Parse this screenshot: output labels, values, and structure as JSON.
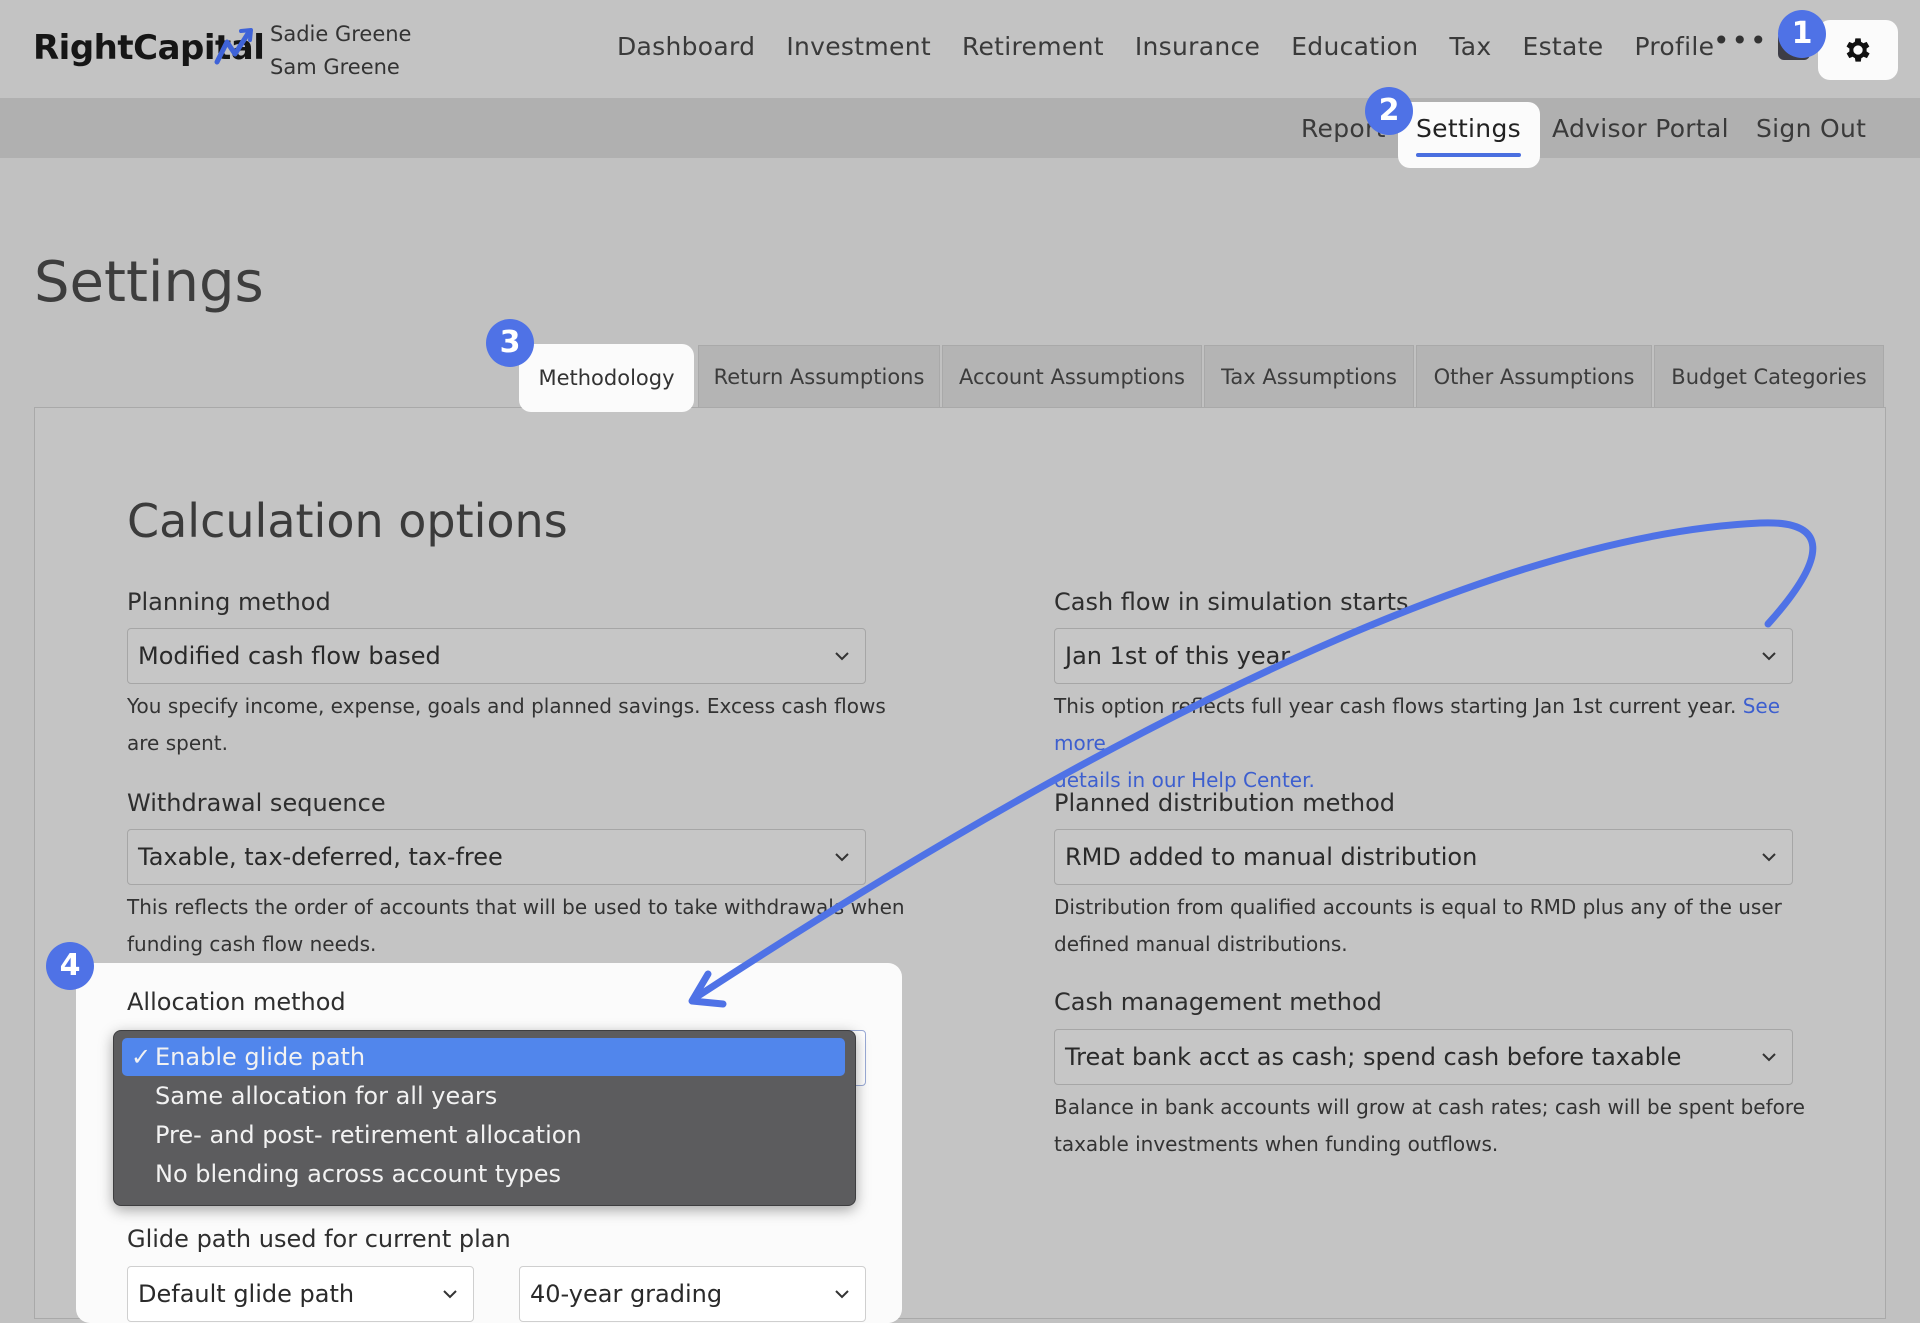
{
  "brand": {
    "name": "RightCapital"
  },
  "clients": [
    "Sadie Greene",
    "Sam Greene"
  ],
  "main_nav": [
    "Dashboard",
    "Investment",
    "Retirement",
    "Insurance",
    "Education",
    "Tax",
    "Estate",
    "Profile"
  ],
  "more_label": "•••",
  "sub_nav": {
    "report": "Report",
    "settings": "Settings",
    "advisor_portal": "Advisor Portal",
    "sign_out": "Sign Out"
  },
  "badges": [
    "1",
    "2",
    "3",
    "4"
  ],
  "page_title": "Settings",
  "tabs": [
    "Methodology",
    "Return Assumptions",
    "Account Assumptions",
    "Tax Assumptions",
    "Other Assumptions",
    "Budget Categories"
  ],
  "section_title": "Calculation options",
  "fields": {
    "planning_method": {
      "label": "Planning method",
      "value": "Modified cash flow based",
      "help1": "You specify income, expense, goals and planned savings. Excess cash flows",
      "help2": "are spent."
    },
    "withdrawal_sequence": {
      "label": "Withdrawal sequence",
      "value": "Taxable, tax-deferred, tax-free",
      "help1": "This reflects the order of accounts that will be used to take withdrawals when",
      "help2": "funding cash flow needs."
    },
    "allocation_method": {
      "label": "Allocation method",
      "options": [
        "Enable glide path",
        "Same allocation for all years",
        "Pre- and post- retirement allocation",
        "No blending across account types"
      ],
      "selected_mark": "✓"
    },
    "glide_path": {
      "label": "Glide path used for current plan",
      "value1": "Default glide path",
      "value2": "40-year grading"
    },
    "cash_flow_start": {
      "label": "Cash flow in simulation starts",
      "value": "Jan 1st of this year",
      "help1": "This option reflects full year cash flows starting Jan 1st current year.",
      "help_link1": "See more",
      "help_link2": "details in our Help Center."
    },
    "distribution_method": {
      "label": "Planned distribution method",
      "value": "RMD added to manual distribution",
      "help1": "Distribution from qualified accounts is equal to RMD plus any of the user",
      "help2": "defined manual distributions."
    },
    "cash_management": {
      "label": "Cash management method",
      "value": "Treat bank acct as cash; spend cash before taxable",
      "help1": "Balance in bank accounts will grow at cash rates; cash will be spent before",
      "help2": "taxable investments when funding outflows."
    }
  },
  "colors": {
    "accent": "#4f72e6",
    "arrow": "#4f72e6",
    "highlight": "#fbfbfb",
    "link": "#3d5fcf"
  }
}
